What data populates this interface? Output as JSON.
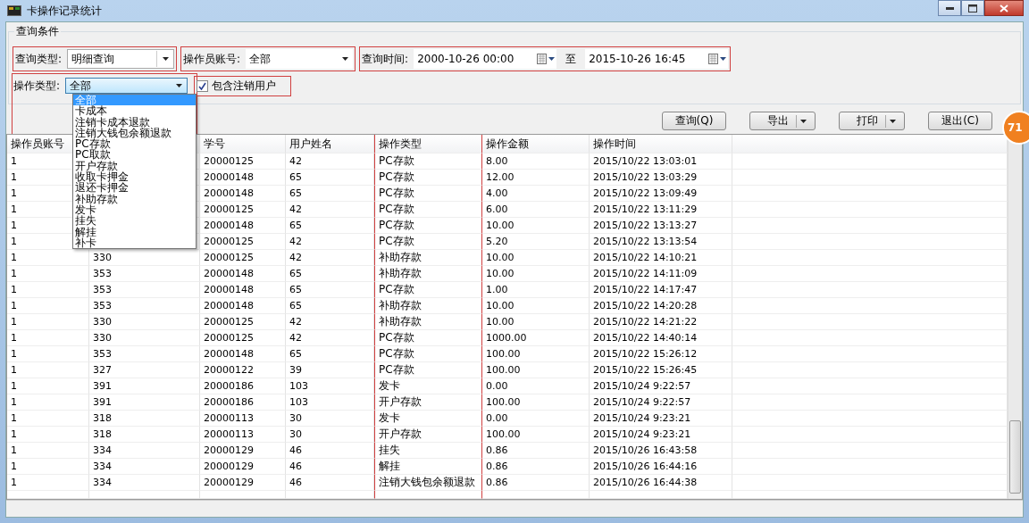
{
  "window": {
    "title": "卡操作记录统计"
  },
  "group_title": "查询条件",
  "filters": [
    {
      "kind": "combo",
      "label": "查询类型:",
      "value": "明细查询",
      "highlighted": true
    },
    {
      "kind": "combo",
      "label": "操作员账号:",
      "value": "全部",
      "highlighted": true
    },
    {
      "kind": "daterange",
      "label": "查询时间:",
      "from": "2000-10-26 00:00",
      "separator": "至",
      "to": "2015-10-26 16:45",
      "highlighted": true
    }
  ],
  "type_filter": {
    "label": "操作类型:",
    "value": "全部",
    "expanded": true,
    "highlighted": true,
    "options": [
      {
        "label": "全部",
        "selected": true
      },
      {
        "label": "卡成本",
        "selected": false
      },
      {
        "label": "注销卡成本退款",
        "selected": false
      },
      {
        "label": "注销大钱包余额退款",
        "selected": false
      },
      {
        "label": "PC存款",
        "selected": false
      },
      {
        "label": "PC取款",
        "selected": false
      },
      {
        "label": "开户存款",
        "selected": false
      },
      {
        "label": "收取卡押金",
        "selected": false
      },
      {
        "label": "退还卡押金",
        "selected": false
      },
      {
        "label": "补助存款",
        "selected": false
      },
      {
        "label": "发卡",
        "selected": false
      },
      {
        "label": "挂失",
        "selected": false
      },
      {
        "label": "解挂",
        "selected": false
      },
      {
        "label": "补卡",
        "selected": false
      }
    ]
  },
  "include_cancelled": {
    "label": "包含注销用户",
    "checked": true,
    "highlighted": true
  },
  "buttons": [
    {
      "label": "查询(Q)",
      "menu": false
    },
    {
      "label": "导出",
      "menu": true
    },
    {
      "label": "打印",
      "menu": true
    },
    {
      "label": "退出(C)",
      "menu": false
    }
  ],
  "table": {
    "columns": [
      {
        "label": "操作员账号"
      },
      {},
      {
        "label": "学号"
      },
      {
        "label": "用户姓名"
      },
      {
        "label": "操作类型",
        "highlighted": true
      },
      {
        "label": "操作金额"
      },
      {
        "label": "操作时间"
      }
    ],
    "rows": [
      [
        "1",
        null,
        "20000125",
        "42",
        "PC存款",
        "8.00",
        "2015/10/22 13:03:01"
      ],
      [
        "1",
        null,
        "20000148",
        "65",
        "PC存款",
        "12.00",
        "2015/10/22 13:03:29"
      ],
      [
        "1",
        null,
        "20000148",
        "65",
        "PC存款",
        "4.00",
        "2015/10/22 13:09:49"
      ],
      [
        "1",
        null,
        "20000125",
        "42",
        "PC存款",
        "6.00",
        "2015/10/22 13:11:29"
      ],
      [
        "1",
        null,
        "20000148",
        "65",
        "PC存款",
        "10.00",
        "2015/10/22 13:13:27"
      ],
      [
        "1",
        null,
        "20000125",
        "42",
        "PC存款",
        "5.20",
        "2015/10/22 13:13:54"
      ],
      [
        "1",
        "330",
        "20000125",
        "42",
        "补助存款",
        "10.00",
        "2015/10/22 14:10:21"
      ],
      [
        "1",
        "353",
        "20000148",
        "65",
        "补助存款",
        "10.00",
        "2015/10/22 14:11:09"
      ],
      [
        "1",
        "353",
        "20000148",
        "65",
        "PC存款",
        "1.00",
        "2015/10/22 14:17:47"
      ],
      [
        "1",
        "353",
        "20000148",
        "65",
        "补助存款",
        "10.00",
        "2015/10/22 14:20:28"
      ],
      [
        "1",
        "330",
        "20000125",
        "42",
        "补助存款",
        "10.00",
        "2015/10/22 14:21:22"
      ],
      [
        "1",
        "330",
        "20000125",
        "42",
        "PC存款",
        "1000.00",
        "2015/10/22 14:40:14"
      ],
      [
        "1",
        "353",
        "20000148",
        "65",
        "PC存款",
        "100.00",
        "2015/10/22 15:26:12"
      ],
      [
        "1",
        "327",
        "20000122",
        "39",
        "PC存款",
        "100.00",
        "2015/10/22 15:26:45"
      ],
      [
        "1",
        "391",
        "20000186",
        "103",
        "发卡",
        "0.00",
        "2015/10/24 9:22:57"
      ],
      [
        "1",
        "391",
        "20000186",
        "103",
        "开户存款",
        "100.00",
        "2015/10/24 9:22:57"
      ],
      [
        "1",
        "318",
        "20000113",
        "30",
        "发卡",
        "0.00",
        "2015/10/24 9:23:21"
      ],
      [
        "1",
        "318",
        "20000113",
        "30",
        "开户存款",
        "100.00",
        "2015/10/24 9:23:21"
      ],
      [
        "1",
        "334",
        "20000129",
        "46",
        "挂失",
        "0.86",
        "2015/10/26 16:43:58"
      ],
      [
        "1",
        "334",
        "20000129",
        "46",
        "解挂",
        "0.86",
        "2015/10/26 16:44:16"
      ],
      [
        "1",
        "334",
        "20000129",
        "46",
        "注销大钱包余额退款",
        "0.86",
        "2015/10/26 16:44:38"
      ]
    ]
  },
  "badge": "71"
}
